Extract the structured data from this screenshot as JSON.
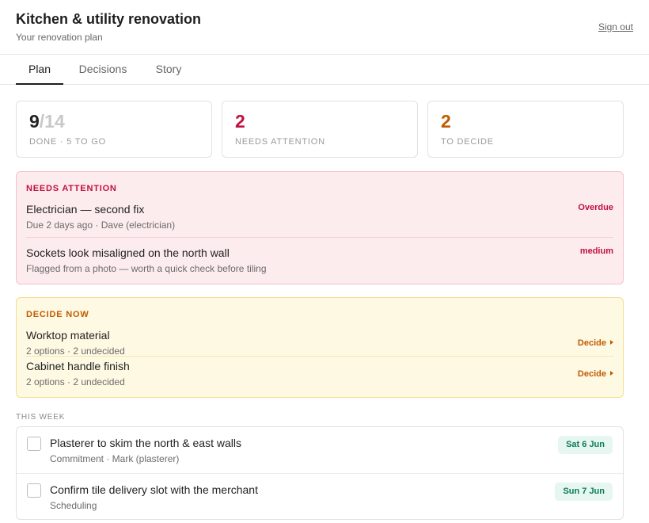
{
  "header": {
    "title": "Kitchen & utility renovation",
    "subtitle": "Your renovation plan",
    "sign_out": "Sign out"
  },
  "tabs": [
    {
      "label": "Plan",
      "active": true
    },
    {
      "label": "Decisions",
      "active": false
    },
    {
      "label": "Story",
      "active": false
    }
  ],
  "stats": {
    "done": {
      "value": "9",
      "total": "/14",
      "label": "DONE · 5 TO GO"
    },
    "attention": {
      "value": "2",
      "label": "NEEDS ATTENTION",
      "color": "#c0103f"
    },
    "decide": {
      "value": "2",
      "label": "TO DECIDE",
      "color": "#c05a00"
    }
  },
  "needs_attention": {
    "title": "NEEDS ATTENTION",
    "items": [
      {
        "title": "Electrician — second fix",
        "meta": "Due 2 days ago · Dave (electrician)",
        "flag": "Overdue"
      },
      {
        "title": "Sockets look misaligned on the north wall",
        "meta": "Flagged from a photo — worth a quick check before tiling",
        "flag": "medium"
      }
    ]
  },
  "decide_now": {
    "title": "DECIDE NOW",
    "items": [
      {
        "title": "Worktop material",
        "meta": "2 options · 2 undecided",
        "action": "Decide"
      },
      {
        "title": "Cabinet handle finish",
        "meta": "2 options · 2 undecided",
        "action": "Decide"
      }
    ]
  },
  "this_week": {
    "label": "THIS WEEK",
    "items": [
      {
        "title": "Plasterer to skim the north & east walls",
        "meta": "Commitment · Mark (plasterer)",
        "date": "Sat 6 Jun"
      },
      {
        "title": "Confirm tile delivery slot with the merchant",
        "meta": "Scheduling",
        "date": "Sun 7 Jun"
      }
    ]
  },
  "colors": {
    "accent_red": "#c0103f",
    "accent_orange": "#c05a00",
    "date_badge_bg": "#e6f6f0",
    "date_badge_text": "#0e7a5a"
  }
}
